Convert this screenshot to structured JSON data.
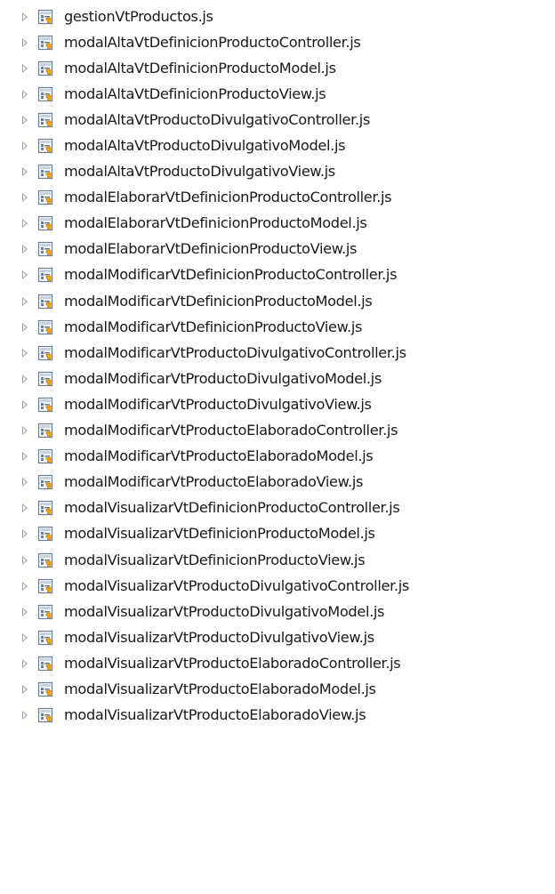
{
  "tree": {
    "items": [
      {
        "label": "gestionVtProductos.js",
        "icon": "js-file-icon"
      },
      {
        "label": "modalAltaVtDefinicionProductoController.js",
        "icon": "js-file-icon"
      },
      {
        "label": "modalAltaVtDefinicionProductoModel.js",
        "icon": "js-file-icon"
      },
      {
        "label": "modalAltaVtDefinicionProductoView.js",
        "icon": "js-file-icon"
      },
      {
        "label": "modalAltaVtProductoDivulgativoController.js",
        "icon": "js-file-icon"
      },
      {
        "label": "modalAltaVtProductoDivulgativoModel.js",
        "icon": "js-file-icon"
      },
      {
        "label": "modalAltaVtProductoDivulgativoView.js",
        "icon": "js-file-icon"
      },
      {
        "label": "modalElaborarVtDefinicionProductoController.js",
        "icon": "js-file-icon"
      },
      {
        "label": "modalElaborarVtDefinicionProductoModel.js",
        "icon": "js-file-icon"
      },
      {
        "label": "modalElaborarVtDefinicionProductoView.js",
        "icon": "js-file-icon"
      },
      {
        "label": "modalModificarVtDefinicionProductoController.js",
        "icon": "js-file-icon"
      },
      {
        "label": "modalModificarVtDefinicionProductoModel.js",
        "icon": "js-file-icon"
      },
      {
        "label": "modalModificarVtDefinicionProductoView.js",
        "icon": "js-file-icon"
      },
      {
        "label": "modalModificarVtProductoDivulgativoController.js",
        "icon": "js-file-icon"
      },
      {
        "label": "modalModificarVtProductoDivulgativoModel.js",
        "icon": "js-file-icon"
      },
      {
        "label": "modalModificarVtProductoDivulgativoView.js",
        "icon": "js-file-icon"
      },
      {
        "label": "modalModificarVtProductoElaboradoController.js",
        "icon": "js-file-icon"
      },
      {
        "label": "modalModificarVtProductoElaboradoModel.js",
        "icon": "js-file-icon"
      },
      {
        "label": "modalModificarVtProductoElaboradoView.js",
        "icon": "js-file-icon"
      },
      {
        "label": "modalVisualizarVtDefinicionProductoController.js",
        "icon": "js-file-icon"
      },
      {
        "label": "modalVisualizarVtDefinicionProductoModel.js",
        "icon": "js-file-icon"
      },
      {
        "label": "modalVisualizarVtDefinicionProductoView.js",
        "icon": "js-file-icon"
      },
      {
        "label": "modalVisualizarVtProductoDivulgativoController.js",
        "icon": "js-file-icon"
      },
      {
        "label": "modalVisualizarVtProductoDivulgativoModel.js",
        "icon": "js-file-icon"
      },
      {
        "label": "modalVisualizarVtProductoDivulgativoView.js",
        "icon": "js-file-icon"
      },
      {
        "label": "modalVisualizarVtProductoElaboradoController.js",
        "icon": "js-file-icon"
      },
      {
        "label": "modalVisualizarVtProductoElaboradoModel.js",
        "icon": "js-file-icon"
      },
      {
        "label": "modalVisualizarVtProductoElaboradoView.js",
        "icon": "js-file-icon"
      }
    ]
  },
  "colors": {
    "background": "#ffffff",
    "text": "#1a1a1a",
    "twisty": "#a7a7a7",
    "icon_frame": "#6a7f97",
    "icon_accent": "#e8a417"
  }
}
